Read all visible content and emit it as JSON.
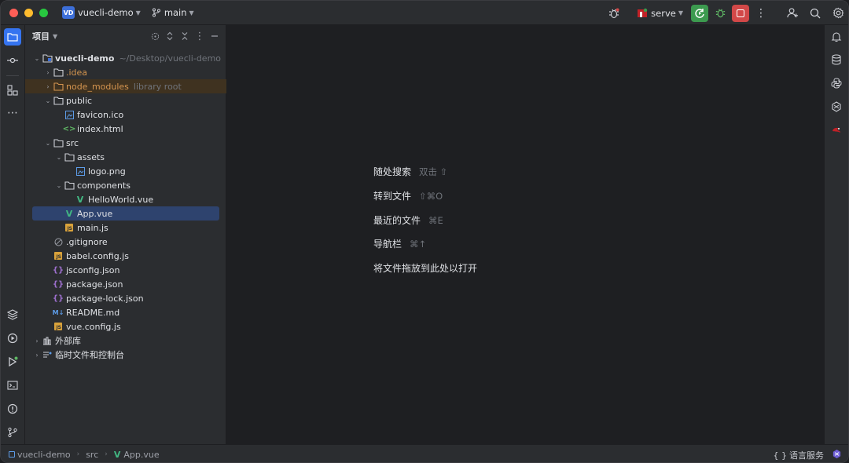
{
  "titlebar": {
    "project_badge": "VD",
    "project_name": "vuecli-demo",
    "branch": "main",
    "run_config": "serve"
  },
  "panel": {
    "title": "项目"
  },
  "tree": [
    {
      "label": "vuecli-demo",
      "extra": "~/Desktop/vuecli-demo"
    },
    {
      "label": ".idea"
    },
    {
      "label": "node_modules",
      "extra": "library root"
    },
    {
      "label": "public"
    },
    {
      "label": "favicon.ico"
    },
    {
      "label": "index.html"
    },
    {
      "label": "src"
    },
    {
      "label": "assets"
    },
    {
      "label": "logo.png"
    },
    {
      "label": "components"
    },
    {
      "label": "HelloWorld.vue"
    },
    {
      "label": "App.vue"
    },
    {
      "label": "main.js"
    },
    {
      "label": ".gitignore"
    },
    {
      "label": "babel.config.js"
    },
    {
      "label": "jsconfig.json"
    },
    {
      "label": "package.json"
    },
    {
      "label": "package-lock.json"
    },
    {
      "label": "README.md"
    },
    {
      "label": "vue.config.js"
    },
    {
      "label": "外部库"
    },
    {
      "label": "临时文件和控制台"
    }
  ],
  "editor_hints": [
    {
      "label": "随处搜索",
      "shortcut": "双击 ⇧"
    },
    {
      "label": "转到文件",
      "shortcut": "⇧⌘O"
    },
    {
      "label": "最近的文件",
      "shortcut": "⌘E"
    },
    {
      "label": "导航栏",
      "shortcut": "⌘↑"
    },
    {
      "label": "将文件拖放到此处以打开",
      "shortcut": ""
    }
  ],
  "statusbar": {
    "crumb_project": "vuecli-demo",
    "crumb_dir": "src",
    "crumb_file": "App.vue",
    "language_services": "语言服务"
  },
  "colors": {
    "accent": "#3574f0",
    "run_green": "#3c9a4f",
    "stop_red": "#d14848",
    "excluded_orange": "#d5954f",
    "vue_green": "#42b883"
  }
}
